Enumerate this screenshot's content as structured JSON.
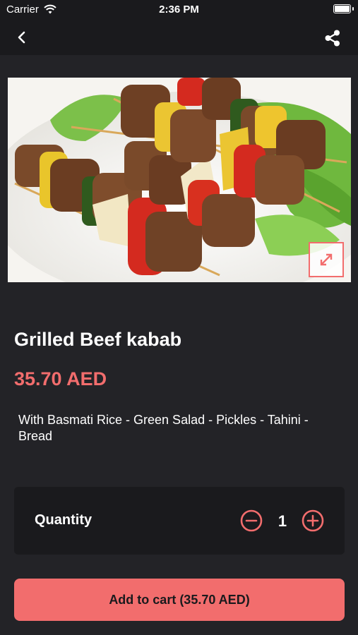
{
  "status_bar": {
    "carrier": "Carrier",
    "time": "2:36 PM"
  },
  "product": {
    "title": "Grilled Beef kabab",
    "price": "35.70 AED",
    "description": "With Basmati Rice - Green Salad - Pickles - Tahini - Bread"
  },
  "quantity": {
    "label": "Quantity",
    "value": "1"
  },
  "cart_button": {
    "label": "Add to cart (35.70 AED)"
  },
  "icons": {
    "back": "chevron-left-icon",
    "share": "share-icon",
    "expand": "expand-icon",
    "minus": "minus-circle-icon",
    "plus": "plus-circle-icon",
    "wifi": "wifi-icon",
    "battery": "battery-icon"
  },
  "colors": {
    "accent": "#f26d6d",
    "background": "#232327",
    "bar": "#1a1a1d",
    "text": "#ffffff"
  }
}
